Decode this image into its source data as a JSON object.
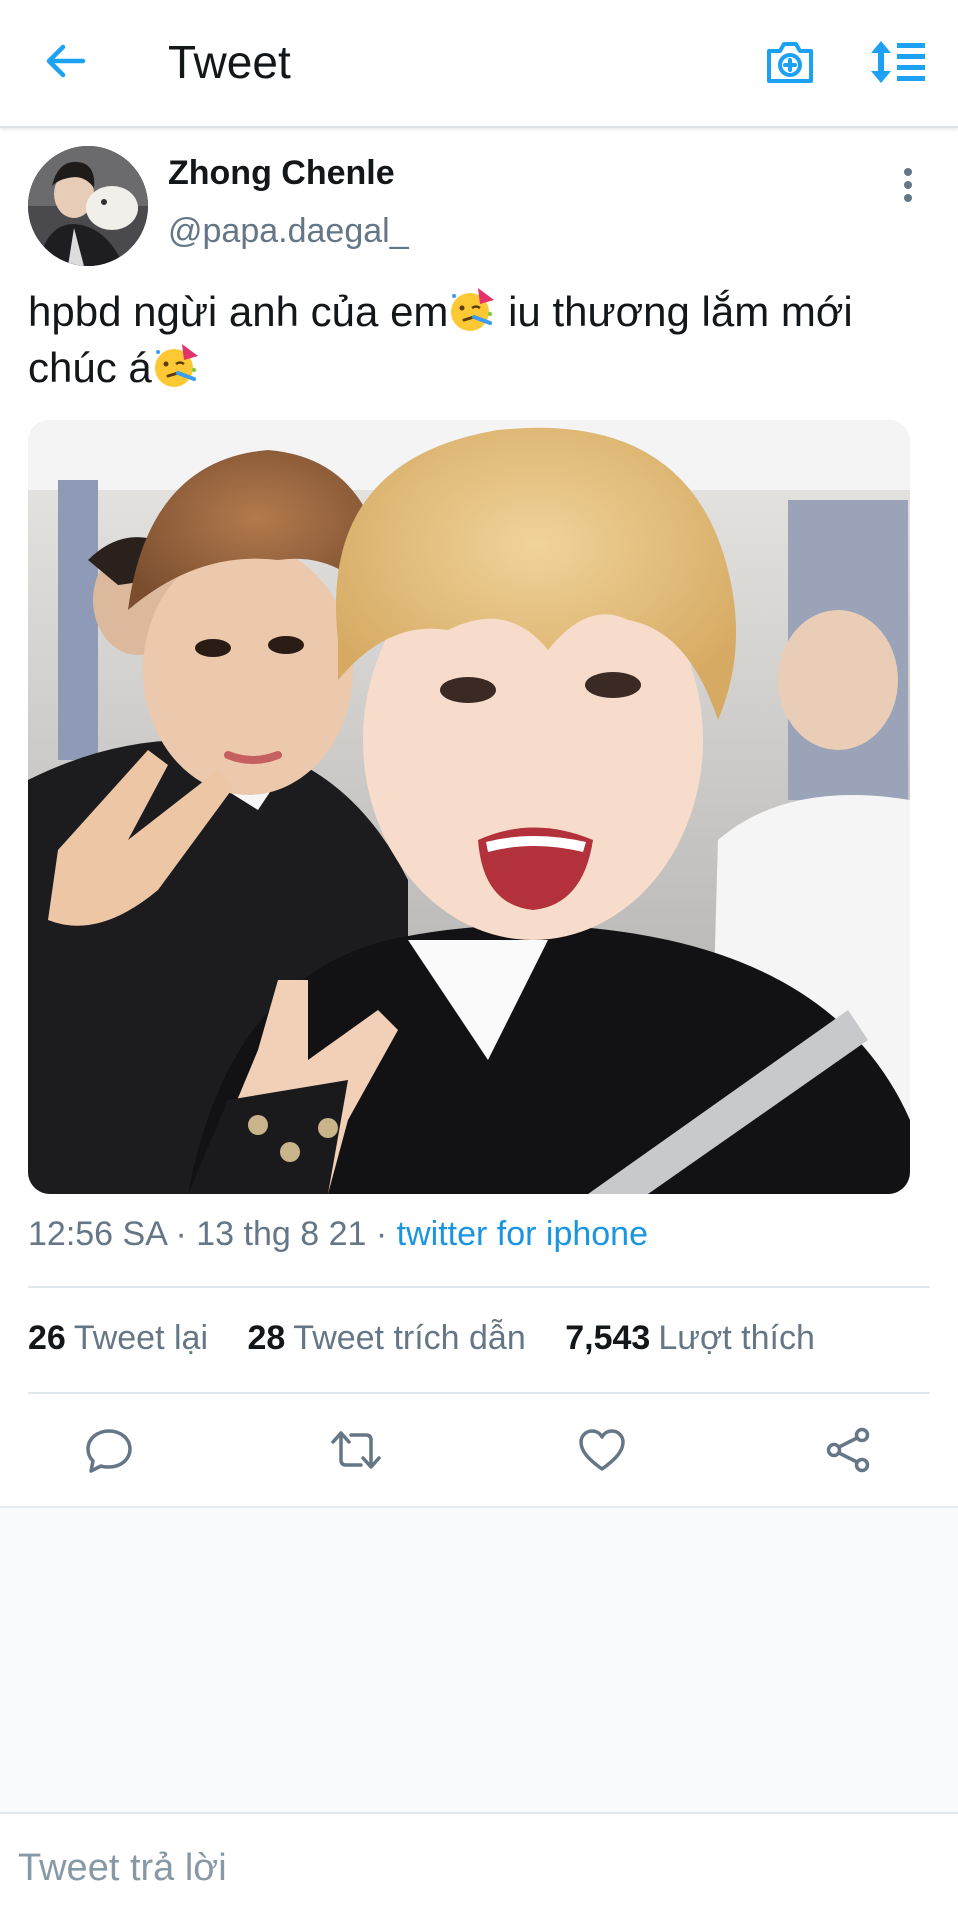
{
  "header": {
    "title": "Tweet",
    "back_icon": "arrow-left-icon",
    "camera_icon": "camera-plus-icon",
    "sort_icon": "sort-list-icon"
  },
  "author": {
    "name": "Zhong Chenle",
    "handle": "@papa.daegal_"
  },
  "tweet": {
    "text_line1_a": "hpbd ngừi anh của em",
    "text_line1_b": " iu thương lắm mới",
    "text_line2": "chúc á",
    "emoji": "partying-face-emoji"
  },
  "meta": {
    "time": "12:56 SA",
    "separator": "·",
    "date": "13 thg 8 21",
    "source": "twitter for iphone"
  },
  "stats": {
    "retweets_count": "26",
    "retweets_label": "Tweet lại",
    "quotes_count": "28",
    "quotes_label": "Tweet trích dẫn",
    "likes_count": "7,543",
    "likes_label": "Lượt thích"
  },
  "actions": {
    "reply_icon": "reply-bubble-icon",
    "retweet_icon": "retweet-icon",
    "like_icon": "heart-icon",
    "share_icon": "share-icon"
  },
  "reply": {
    "placeholder": "Tweet trả lời"
  },
  "colors": {
    "accent": "#1da1f2",
    "link": "#1b95e0",
    "secondary_text": "#657786",
    "divider": "#e1e8ed"
  }
}
